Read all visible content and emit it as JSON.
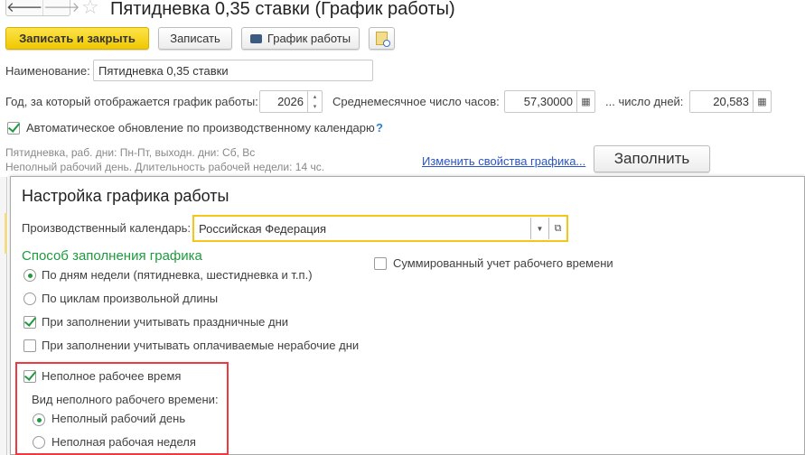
{
  "window": {
    "title": "Пятидневка 0,35 ставки (График работы)"
  },
  "toolbar": {
    "save_close": "Записать и закрыть",
    "save": "Записать",
    "schedule": "График работы"
  },
  "form": {
    "name_label": "Наименование:",
    "name_value": "Пятидневка 0,35 ставки",
    "year_label": "Год, за который отображается график работы:",
    "year_value": "2026",
    "avg_hours_label": "Среднемесячное число часов:",
    "avg_hours_value": "57,30000",
    "avg_days_label": "... число дней:",
    "avg_days_value": "20,583",
    "auto_update_label": "Автоматическое обновление по производственному календарю",
    "auto_update_checked": true,
    "help": "?",
    "info_line1": "Пятидневка, раб. дни: Пн-Пт, выходн. дни: Сб, Вс",
    "info_line2": "Неполный рабочий день. Длительность рабочей недели: 14 чс.",
    "change_link": "Изменить свойства графика...",
    "fill_button": "Заполнить"
  },
  "dialog": {
    "title": "Настройка графика работы",
    "calendar_label": "Производственный календарь:",
    "calendar_value": "Российская Федерация",
    "section_title": "Способ заполнения графика",
    "radio_weekdays": "По дням недели (пятидневка, шестидневка и т.п.)",
    "radio_cycles": "По циклам произвольной длины",
    "cb_holidays": "При заполнении учитывать праздничные дни",
    "cb_paid_nonworking": "При заполнении учитывать оплачиваемые нерабочие дни",
    "cb_summarized": "Суммированный учет рабочего времени",
    "cb_part_time": "Неполное рабочее время",
    "part_time_kind_label": "Вид неполного рабочего времени:",
    "radio_part_day": "Неполный рабочий день",
    "radio_part_week": "Неполная рабочая неделя"
  },
  "colors": {
    "accent_yellow": "#f5d10a",
    "section_green": "#1e9b3e",
    "highlight_red": "#f0393f",
    "link": "#2b54c4"
  }
}
